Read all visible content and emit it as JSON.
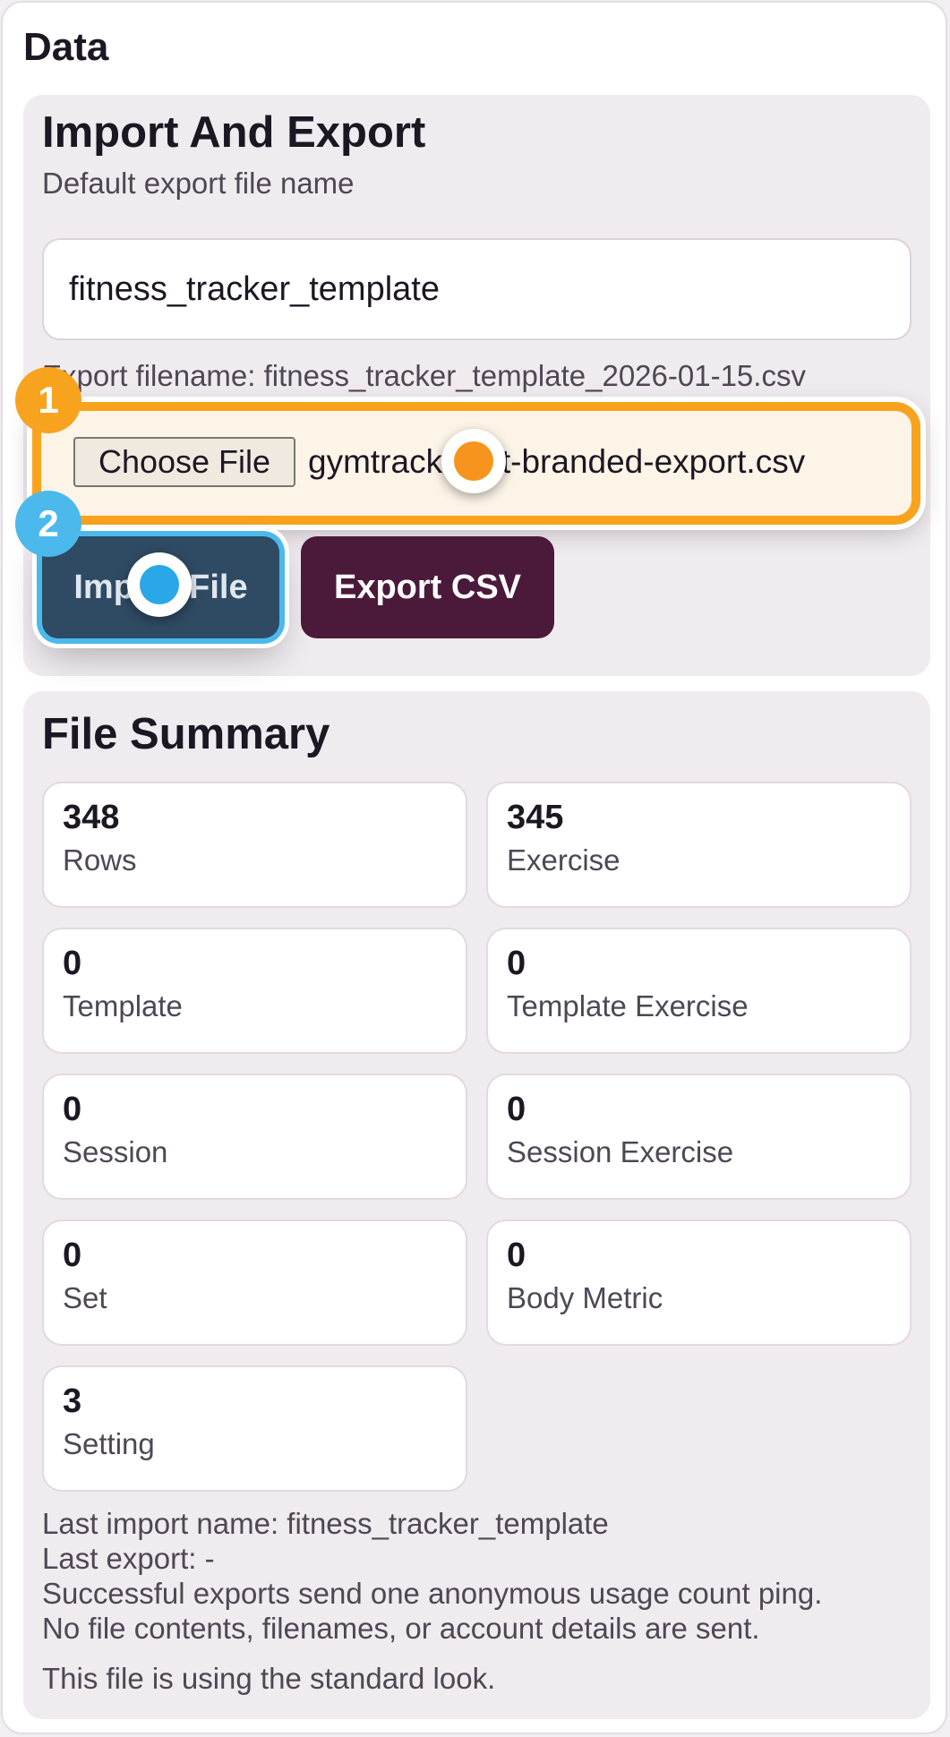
{
  "page": {
    "title": "Data"
  },
  "import_export": {
    "heading": "Import And Export",
    "default_name_label": "Default export file name",
    "default_name_value": "fitness_tracker_template",
    "export_filename_text": "Export filename: fitness_tracker_template_2026-01-15.csv",
    "choose_file_label": "Choose File",
    "selected_file": "gymtracker-pt-branded-export.csv",
    "import_button": "Import File",
    "export_button": "Export CSV"
  },
  "markers": [
    {
      "number": "1",
      "color": "#f7a31e",
      "target": "file-input"
    },
    {
      "number": "2",
      "color": "#4bb9ec",
      "target": "import-button"
    }
  ],
  "file_summary": {
    "heading": "File Summary",
    "stats": [
      {
        "value": "348",
        "label": "Rows"
      },
      {
        "value": "345",
        "label": "Exercise"
      },
      {
        "value": "0",
        "label": "Template"
      },
      {
        "value": "0",
        "label": "Template Exercise"
      },
      {
        "value": "0",
        "label": "Session"
      },
      {
        "value": "0",
        "label": "Session Exercise"
      },
      {
        "value": "0",
        "label": "Set"
      },
      {
        "value": "0",
        "label": "Body Metric"
      },
      {
        "value": "3",
        "label": "Setting"
      }
    ],
    "notes": [
      "Last import name: fitness_tracker_template",
      "Last export: -",
      "Successful exports send one anonymous usage count ping.",
      "No file contents, filenames, or account details are sent."
    ],
    "look_note": "This file is using the standard look."
  }
}
